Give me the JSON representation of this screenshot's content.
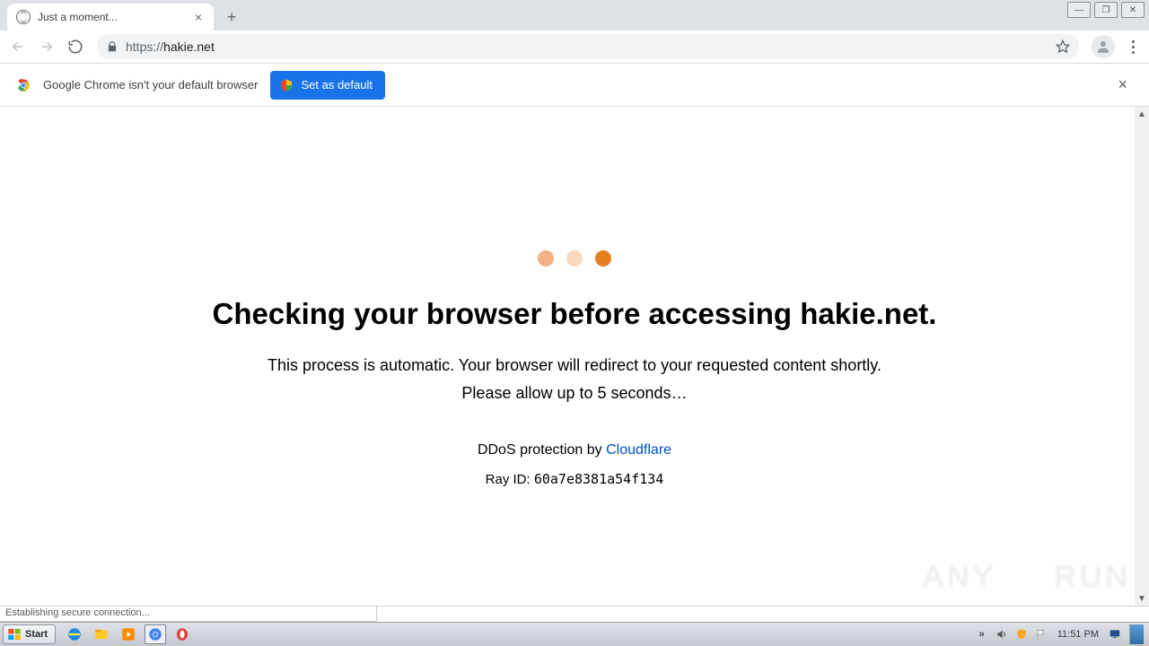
{
  "window": {
    "minimize": "—",
    "maximize": "❐",
    "close": "✕"
  },
  "tab": {
    "title": "Just a moment...",
    "close": "×"
  },
  "newtab": "+",
  "toolbar": {
    "url_scheme": "https://",
    "url_host": "hakie.net"
  },
  "infobar": {
    "message": "Google Chrome isn't your default browser",
    "button": "Set as default",
    "close": "×"
  },
  "page": {
    "heading": "Checking your browser before accessing hakie.net.",
    "line1": "This process is automatic. Your browser will redirect to your requested content shortly.",
    "line2": "Please allow up to 5 seconds…",
    "ddos_prefix": "DDoS protection by ",
    "ddos_link": "Cloudflare",
    "ray_label": "Ray ID: ",
    "ray_id": "60a7e8381a54f134"
  },
  "statusbar": {
    "text": "Establishing secure connection..."
  },
  "taskbar": {
    "start": "Start",
    "clock": "11:51 PM"
  },
  "watermark": {
    "left": "ANY",
    "right": "RUN"
  }
}
